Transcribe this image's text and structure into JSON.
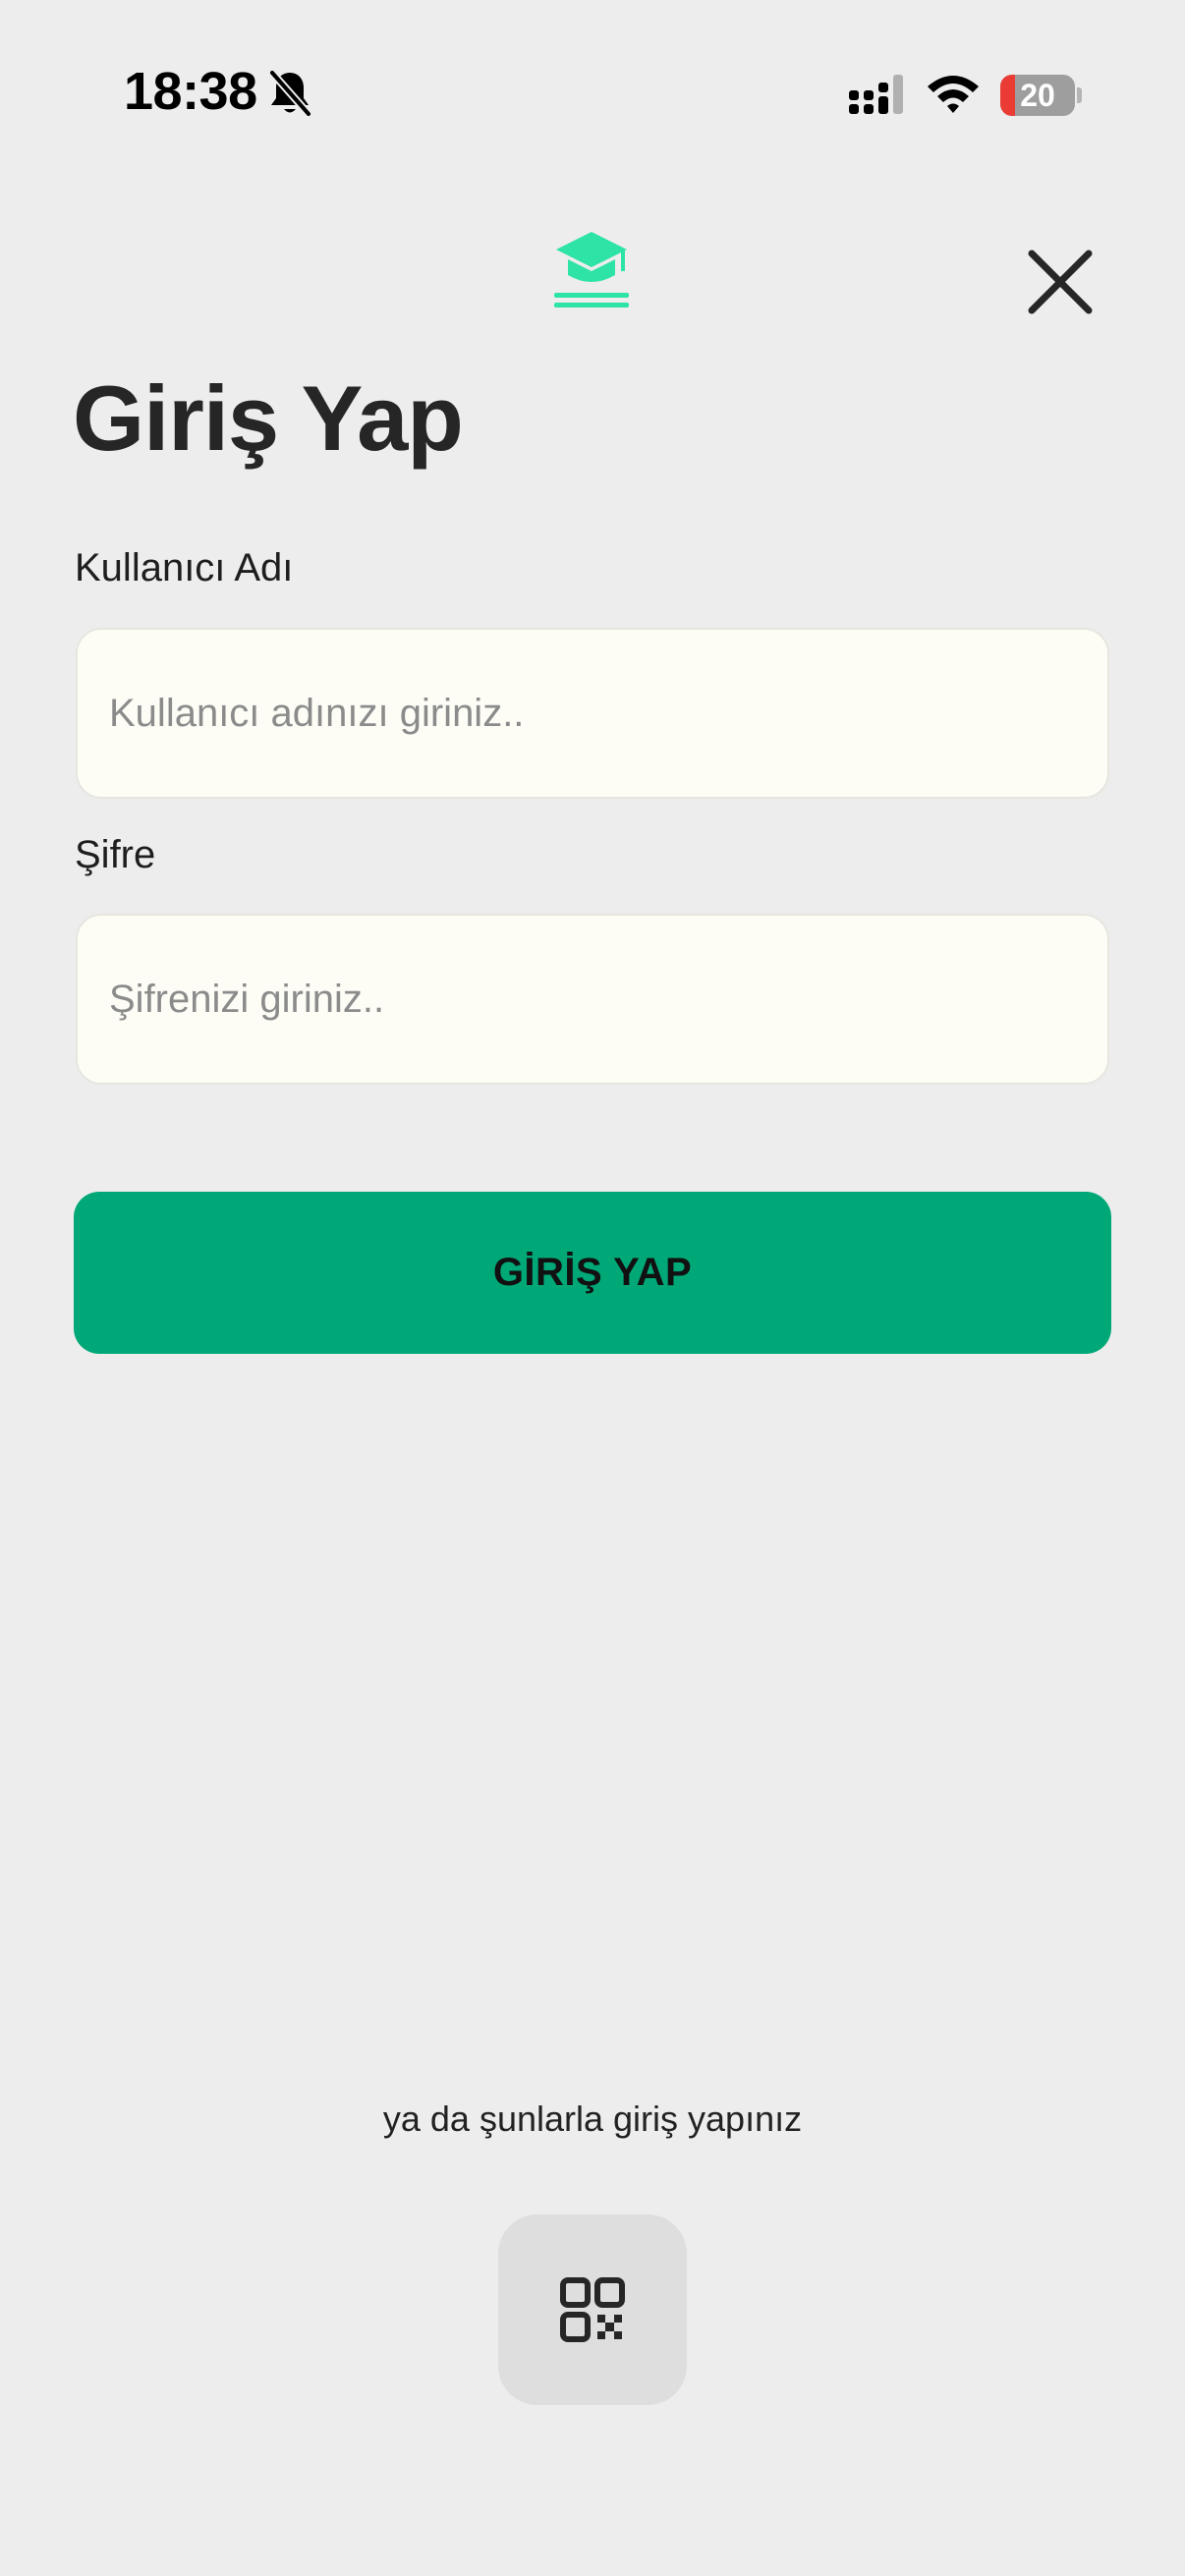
{
  "status_bar": {
    "time": "18:38",
    "battery_percent": "20",
    "battery_level": 0.2,
    "silent_icon": "bell-slash-icon",
    "signal_icon": "cellular-signal-icon",
    "wifi_icon": "wifi-icon"
  },
  "header": {
    "logo_icon": "graduation-cap-icon",
    "close_icon": "close-icon",
    "title": "Giriş Yap"
  },
  "form": {
    "username": {
      "label": "Kullanıcı Adı",
      "placeholder": "Kullanıcı adınızı giriniz..",
      "value": ""
    },
    "password": {
      "label": "Şifre",
      "placeholder": "Şifrenizi giriniz..",
      "value": ""
    },
    "submit_label": "GİRİŞ YAP"
  },
  "alternative": {
    "text": "ya da şunlarla giriş yapınız",
    "qr_icon": "qr-code-icon"
  },
  "colors": {
    "accent": "#00a877",
    "logo": "#2ee3a6",
    "background": "#ededed",
    "field_background": "#fdfdf6",
    "battery_low": "#eb3b35"
  }
}
